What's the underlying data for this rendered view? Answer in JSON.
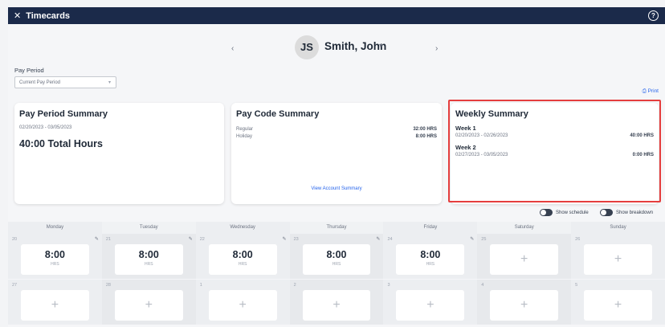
{
  "window": {
    "title": "Timecards",
    "close_icon": "close-icon",
    "help_icon": "help-icon"
  },
  "employee": {
    "initials": "JS",
    "name": "Smith, John",
    "prev_arrow": "‹",
    "next_arrow": "›",
    "caret": "▾"
  },
  "pay_period": {
    "label": "Pay Period",
    "selected": "Current Pay Period",
    "caret": "▾"
  },
  "print": {
    "label": "Print",
    "icon": "printer-icon"
  },
  "pay_period_summary": {
    "title": "Pay Period Summary",
    "range": "02/20/2023 - 03/05/2023",
    "total": "40:00 Total Hours"
  },
  "pay_code_summary": {
    "title": "Pay Code Summary",
    "rows": [
      {
        "label": "Regular",
        "value": "32:00 HRS"
      },
      {
        "label": "Holiday",
        "value": "8:00 HRS"
      }
    ],
    "link": "View Account Summary"
  },
  "weekly_summary": {
    "title": "Weekly Summary",
    "weeks": [
      {
        "name": "Week 1",
        "range": "02/20/2023 - 02/26/2023",
        "hours": "40:00 HRS"
      },
      {
        "name": "Week 2",
        "range": "02/27/2023 - 03/05/2023",
        "hours": "0:00 HRS"
      }
    ]
  },
  "toggles": {
    "schedule": "Show schedule",
    "breakdown": "Show breakdown"
  },
  "calendar": {
    "days": [
      "Monday",
      "Tuesday",
      "Wednesday",
      "Thursday",
      "Friday",
      "Saturday",
      "Sunday"
    ],
    "week1": [
      {
        "num": "20",
        "value": "8:00",
        "unit": "HRS"
      },
      {
        "num": "21",
        "value": "8:00",
        "unit": "HRS"
      },
      {
        "num": "22",
        "value": "8:00",
        "unit": "HRS"
      },
      {
        "num": "23",
        "value": "8:00",
        "unit": "HRS"
      },
      {
        "num": "24",
        "value": "8:00",
        "unit": "HRS"
      },
      {
        "num": "25",
        "value": "",
        "unit": ""
      },
      {
        "num": "26",
        "value": "",
        "unit": ""
      }
    ],
    "week2": [
      {
        "num": "27"
      },
      {
        "num": "28"
      },
      {
        "num": "1"
      },
      {
        "num": "2"
      },
      {
        "num": "3"
      },
      {
        "num": "4"
      },
      {
        "num": "5"
      }
    ],
    "add_symbol": "+",
    "edit_symbol": "✎"
  },
  "colors": {
    "header": "#1b2a4a",
    "link": "#2563eb",
    "highlight": "#e53e3e"
  }
}
